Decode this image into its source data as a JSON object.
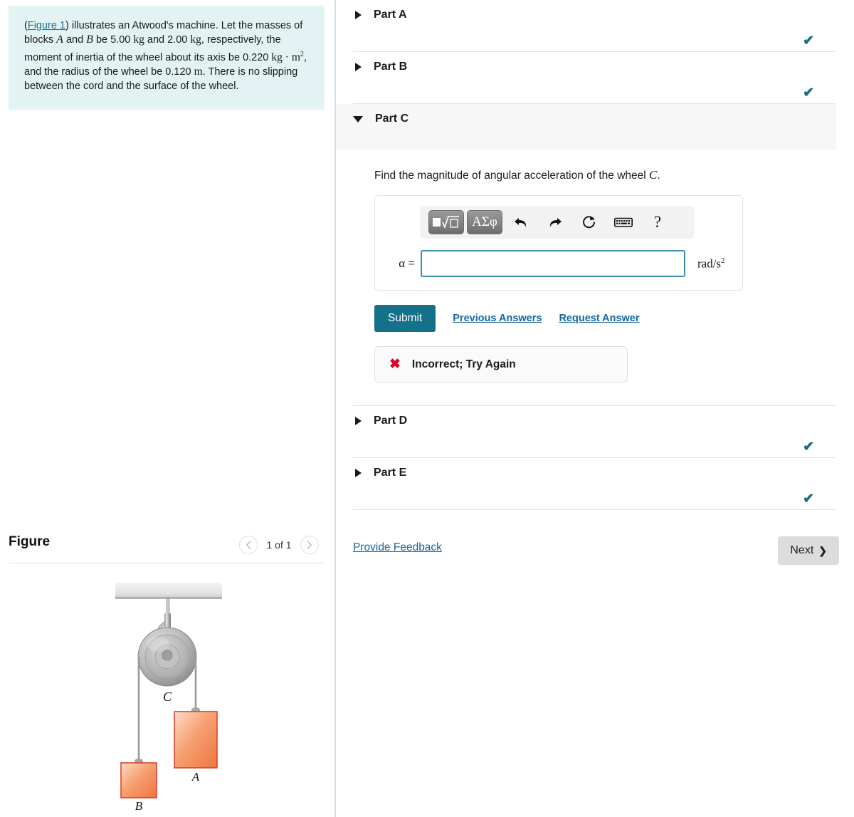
{
  "problem": {
    "figure_link": "Figure 1",
    "text_before": "(",
    "text_part1": ") illustrates an Atwood's machine. Let the masses of blocks ",
    "block_a": "A",
    "text_part2": " and ",
    "block_b": "B",
    "text_part3": " be 5.00 ",
    "unit_kg_1": "kg",
    "text_part4": " and 2.00 ",
    "unit_kg_2": "kg",
    "text_part5": ", respectively, the moment of inertia of the wheel about its axis be 0.220 ",
    "unit_kgm2": "kg · m",
    "unit_kgm2_sup": "2",
    "text_part6": ", and the radius of the wheel be 0.120 ",
    "unit_m": "m",
    "text_part7": ". There is no slipping between the cord and the surface of the wheel."
  },
  "figure": {
    "title": "Figure",
    "page_label": "1 of 1",
    "prev_icon": "chevron-left",
    "next_icon": "chevron-right",
    "labels": {
      "wheel": "C",
      "block_a": "A",
      "block_b": "B"
    },
    "colors": {
      "block_fill_light": "#fbd0b6",
      "block_fill_dark": "#ef7a45",
      "block_border": "#d9452b",
      "pulley_gray": "#b9b9b9",
      "ceiling_gray": "#e6e6e6",
      "cord_gray": "#9a9a9a"
    }
  },
  "parts": [
    {
      "label": "Part A",
      "state": "collapsed",
      "status_icon": "check",
      "caret": "right"
    },
    {
      "label": "Part B",
      "state": "collapsed",
      "status_icon": "check",
      "caret": "right"
    },
    {
      "label": "Part C",
      "state": "expanded",
      "status_icon": "",
      "caret": "down"
    },
    {
      "label": "Part D",
      "state": "collapsed",
      "status_icon": "check",
      "caret": "right"
    },
    {
      "label": "Part E",
      "state": "collapsed",
      "status_icon": "check",
      "caret": "right"
    }
  ],
  "part_c": {
    "question_text": "Find the magnitude of angular acceleration of the wheel ",
    "question_var": "C",
    "question_end": ".",
    "toolbar": {
      "template_key_label": "■√□",
      "greek_key_label": "ΑΣφ",
      "undo_icon": "undo-arrow",
      "redo_icon": "redo-arrow",
      "reset_icon": "reset-circular-arrow",
      "keyboard_icon": "keyboard",
      "help_icon": "?"
    },
    "answer_label": "α =",
    "answer_value": "",
    "answer_placeholder": "",
    "answer_units_main": "rad/s",
    "answer_units_sup": "2",
    "submit_label": "Submit",
    "previous_answers_label": "Previous Answers",
    "request_answer_label": "Request Answer",
    "feedback_icon": "✖",
    "feedback_text": "Incorrect; Try Again"
  },
  "footer": {
    "provide_feedback_label": "Provide Feedback",
    "next_label": "Next",
    "next_icon": "❯"
  },
  "status_check_glyph": "✔",
  "colors": {
    "accent_teal": "#15708a",
    "link_blue": "#1566a0",
    "check_teal": "#1a6a80",
    "error_red": "#e00024",
    "info_bg": "#e3f2f2"
  }
}
